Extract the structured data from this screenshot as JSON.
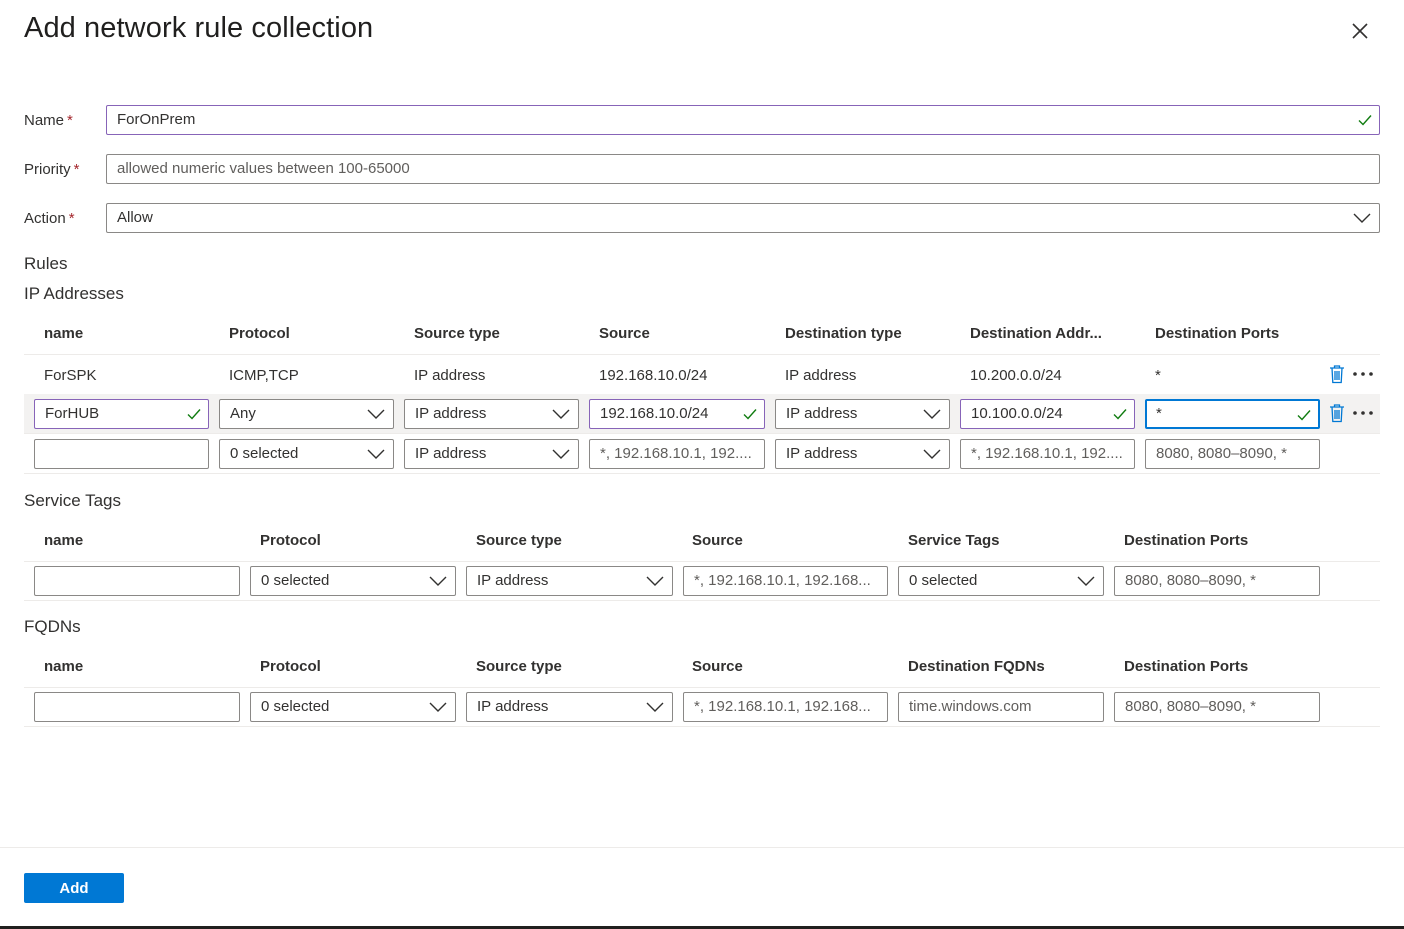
{
  "title": "Add network rule collection",
  "form": {
    "name_label": "Name",
    "name_value": "ForOnPrem",
    "priority_label": "Priority",
    "priority_placeholder": "allowed numeric values between 100-65000",
    "action_label": "Action",
    "action_value": "Allow",
    "required_mark": "*"
  },
  "rules_heading": "Rules",
  "ip_addresses": {
    "heading": "IP Addresses",
    "columns": [
      "name",
      "Protocol",
      "Source type",
      "Source",
      "Destination type",
      "Destination Addr...",
      "Destination Ports"
    ],
    "static_row": {
      "name": "ForSPK",
      "protocol": "ICMP,TCP",
      "source_type": "IP address",
      "source": "192.168.10.0/24",
      "destination_type": "IP address",
      "destination_address": "10.200.0.0/24",
      "destination_ports": "*"
    },
    "edit_row": {
      "name": "ForHUB",
      "protocol": "Any",
      "source_type": "IP address",
      "source": "192.168.10.0/24",
      "destination_type": "IP address",
      "destination_address": "10.100.0.0/24",
      "destination_ports": "*"
    },
    "new_row": {
      "name": "",
      "protocol": "0 selected",
      "source_type": "IP address",
      "source_placeholder": "*, 192.168.10.1, 192....",
      "destination_type": "IP address",
      "destination_placeholder": "*, 192.168.10.1, 192....",
      "ports_placeholder": "8080, 8080–8090, *"
    }
  },
  "service_tags": {
    "heading": "Service Tags",
    "columns": [
      "name",
      "Protocol",
      "Source type",
      "Source",
      "Service Tags",
      "Destination Ports"
    ],
    "new_row": {
      "name": "",
      "protocol": "0 selected",
      "source_type": "IP address",
      "source_placeholder": "*, 192.168.10.1, 192.168...",
      "service_tags": "0 selected",
      "ports_placeholder": "8080, 8080–8090, *"
    }
  },
  "fqdns": {
    "heading": "FQDNs",
    "columns": [
      "name",
      "Protocol",
      "Source type",
      "Source",
      "Destination FQDNs",
      "Destination Ports"
    ],
    "new_row": {
      "name": "",
      "protocol": "0 selected",
      "source_type": "IP address",
      "source_placeholder": "*, 192.168.10.1, 192.168...",
      "fqdn_placeholder": "time.windows.com",
      "ports_placeholder": "8080, 8080–8090, *"
    }
  },
  "footer": {
    "add_label": "Add"
  },
  "icons": {
    "close": "close-icon",
    "check": "checkmark-icon",
    "chevron": "chevron-down-icon",
    "delete": "trash-icon",
    "more": "more-icon"
  },
  "colors": {
    "accent": "#0078d4",
    "focus_border": "#8764b8",
    "success": "#107c10",
    "required": "#a4262c"
  }
}
